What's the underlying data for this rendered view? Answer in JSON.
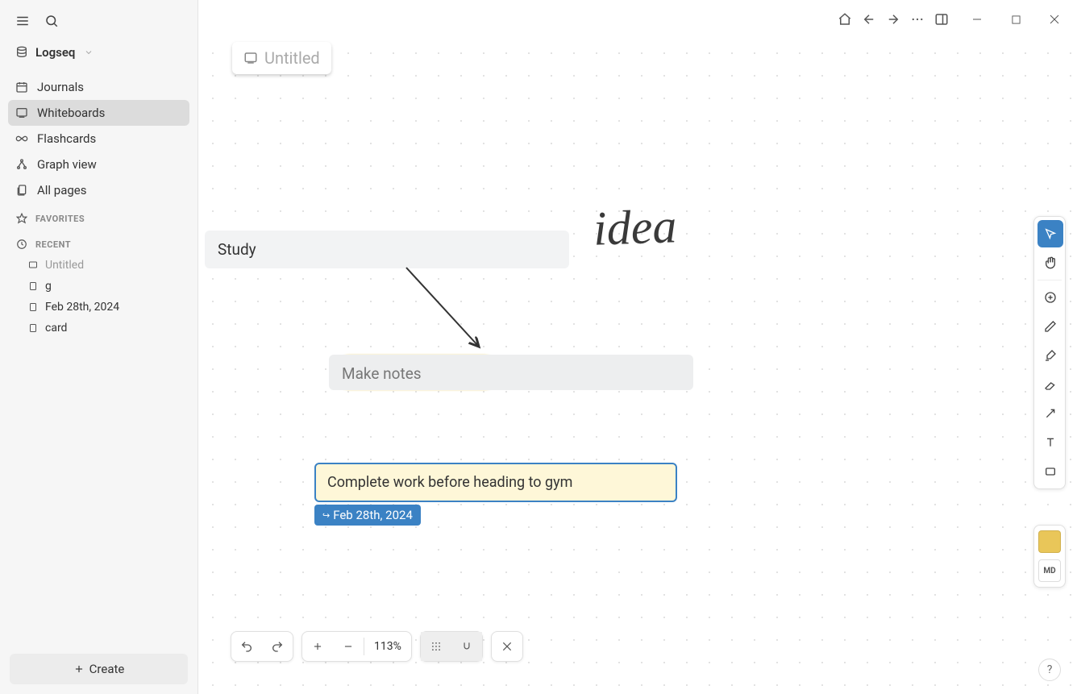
{
  "app": {
    "name": "Logseq"
  },
  "sidebar": {
    "nav": [
      {
        "label": "Journals"
      },
      {
        "label": "Whiteboards"
      },
      {
        "label": "Flashcards"
      },
      {
        "label": "Graph view"
      },
      {
        "label": "All pages"
      }
    ],
    "sections": {
      "favorites": "FAVORITES",
      "recent": "RECENT"
    },
    "recent": [
      {
        "label": "Untitled"
      },
      {
        "label": "g"
      },
      {
        "label": "Feb 28th, 2024"
      },
      {
        "label": "card"
      }
    ],
    "create": "Create"
  },
  "page": {
    "title": "Untitled"
  },
  "canvas": {
    "study": "Study",
    "notes": "Make notes",
    "task": "Complete work before heading to gym",
    "date": "Feb 28th, 2024",
    "handwriting": "idea"
  },
  "bottombar": {
    "zoom": "113%"
  },
  "right_tools": {
    "md_label": "MD",
    "swatch_color": "#e9c659"
  },
  "help": "?"
}
